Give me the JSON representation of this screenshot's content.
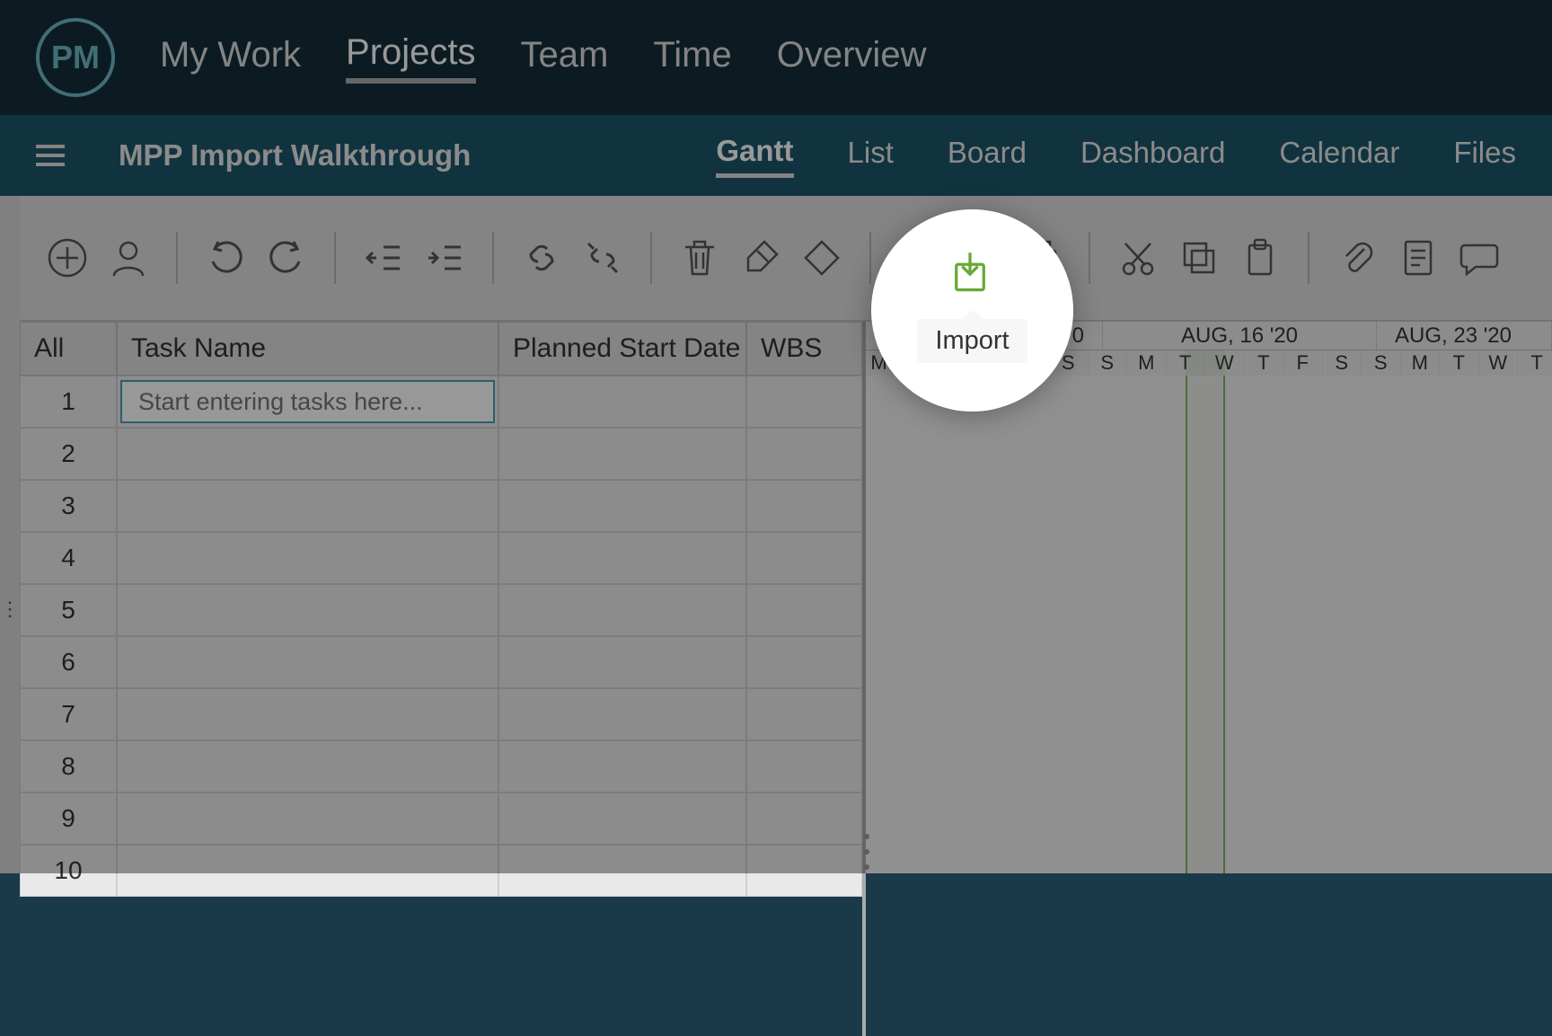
{
  "logo_text": "PM",
  "topnav": {
    "items": [
      {
        "label": "My Work"
      },
      {
        "label": "Projects",
        "active": true
      },
      {
        "label": "Team"
      },
      {
        "label": "Time"
      },
      {
        "label": "Overview"
      }
    ]
  },
  "project": {
    "title": "MPP Import Walkthrough"
  },
  "subnav": {
    "items": [
      {
        "label": "Gantt",
        "active": true
      },
      {
        "label": "List"
      },
      {
        "label": "Board"
      },
      {
        "label": "Dashboard"
      },
      {
        "label": "Calendar"
      },
      {
        "label": "Files"
      }
    ]
  },
  "tooltip": {
    "label": "Import"
  },
  "grid": {
    "headers": {
      "col0": "All",
      "col1": "Task Name",
      "col2": "Planned Start Date",
      "col3": "WBS"
    },
    "task_placeholder": "Start entering tasks here...",
    "rows": [
      "1",
      "2",
      "3",
      "4",
      "5",
      "6",
      "7",
      "8",
      "9",
      "10"
    ]
  },
  "timeline": {
    "weeks": [
      "AUG, 9 '20",
      "AUG, 16 '20",
      "AUG, 23 '20"
    ],
    "week0_suffix": "0",
    "days": [
      "M",
      "T",
      "W",
      "T",
      "F",
      "S",
      "S",
      "M",
      "T",
      "W",
      "T",
      "F",
      "S",
      "S",
      "M",
      "T",
      "W",
      "T"
    ]
  },
  "colors": {
    "accent_green": "#7bb661",
    "accent_teal": "#4a9db8"
  }
}
